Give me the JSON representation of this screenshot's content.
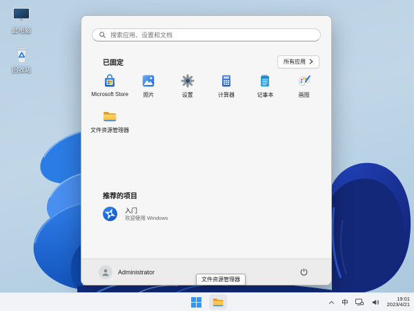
{
  "desktop": {
    "icons": [
      {
        "label": "此电脑",
        "icon": "this-pc-icon"
      },
      {
        "label": "回收站",
        "icon": "recycle-bin-icon"
      }
    ]
  },
  "start_menu": {
    "search": {
      "placeholder": "搜索应用、设置和文档"
    },
    "pinned": {
      "header": "已固定",
      "all_apps_label": "所有应用",
      "apps": [
        {
          "label": "Microsoft Store",
          "icon": "microsoft-store-icon"
        },
        {
          "label": "照片",
          "icon": "photos-icon"
        },
        {
          "label": "设置",
          "icon": "settings-icon"
        },
        {
          "label": "计算器",
          "icon": "calculator-icon"
        },
        {
          "label": "记事本",
          "icon": "notepad-icon"
        },
        {
          "label": "画图",
          "icon": "paint-icon"
        },
        {
          "label": "文件资源管理器",
          "icon": "file-explorer-icon"
        }
      ]
    },
    "recommended": {
      "header": "推荐的项目",
      "items": [
        {
          "title": "入门",
          "subtitle": "欢迎使用 Windows",
          "icon": "get-started-icon"
        }
      ]
    },
    "footer": {
      "user_name": "Administrator"
    }
  },
  "tooltip": {
    "text": "文件资源管理器"
  },
  "taskbar": {
    "tray": {
      "ime_label": "中",
      "time": "19:01",
      "date": "2023/4/21"
    }
  },
  "colors": {
    "accent_blue": "#1d6fd4",
    "bloom_light_blue": "#2b7ce4",
    "bloom_navy": "#132879",
    "menu_bg": "#f6f6f6",
    "taskbar_bg": "#f2f3f6"
  }
}
